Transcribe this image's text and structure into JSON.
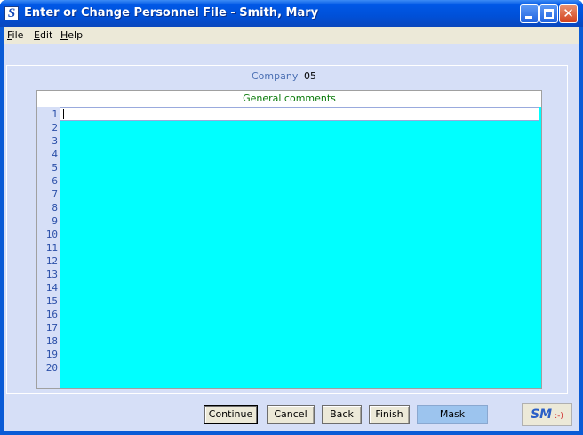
{
  "window": {
    "title": "Enter or Change Personnel File - Smith, Mary",
    "icon": "S"
  },
  "menu": [
    {
      "label": "File"
    },
    {
      "label": "Edit"
    },
    {
      "label": "Help"
    }
  ],
  "form": {
    "company_label": "Company",
    "company_value": "05",
    "comments_title": "General comments",
    "line_numbers": [
      "1",
      "2",
      "3",
      "4",
      "5",
      "6",
      "7",
      "8",
      "9",
      "10",
      "11",
      "12",
      "13",
      "14",
      "15",
      "16",
      "17",
      "18",
      "19",
      "20"
    ]
  },
  "buttons": {
    "continue": "Continue",
    "cancel": "Cancel",
    "back": "Back",
    "finish": "Finish",
    "mask": "Mask"
  },
  "logo": {
    "text": "SM",
    "smiley": ":-)"
  },
  "colors": {
    "edit_background": "#00ffff",
    "panel_background": "#d6dff7",
    "comments_title": "#0a7a0a",
    "label_blue": "#4a6fb3",
    "titlebar": "#0058e6"
  }
}
